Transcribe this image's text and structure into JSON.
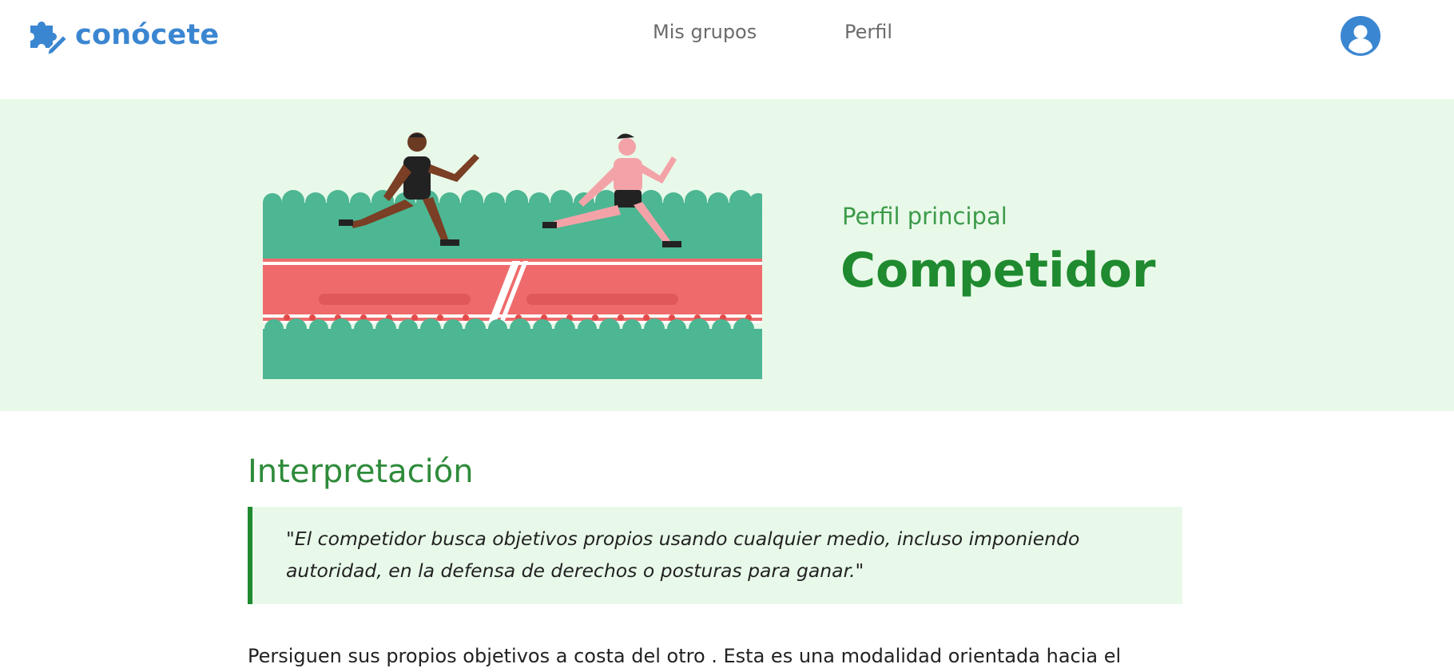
{
  "header": {
    "logo_text": "conócete",
    "logo_icon": "puzzle-pencil-icon",
    "nav": [
      {
        "label": "Mis grupos"
      },
      {
        "label": "Perfil"
      }
    ],
    "avatar_icon": "user-avatar-icon"
  },
  "hero": {
    "illustration": "runners-race-illustration",
    "subtitle": "Perfil principal",
    "title": "Competidor"
  },
  "content": {
    "section_title": "Interpretación",
    "quote": "\"El competidor busca objetivos propios usando cualquier medio, incluso imponiendo autoridad, en la defensa de derechos o posturas para ganar.\"",
    "body": "Persiguen sus propios objetivos a costa del otro . Esta es una modalidad orientada hacia el"
  },
  "colors": {
    "brand_blue": "#3b86d1",
    "accent_green": "#1f8a2f",
    "light_green_bg": "#e8f9e9",
    "track_red": "#ef6b6b",
    "grass_green": "#4db693"
  }
}
